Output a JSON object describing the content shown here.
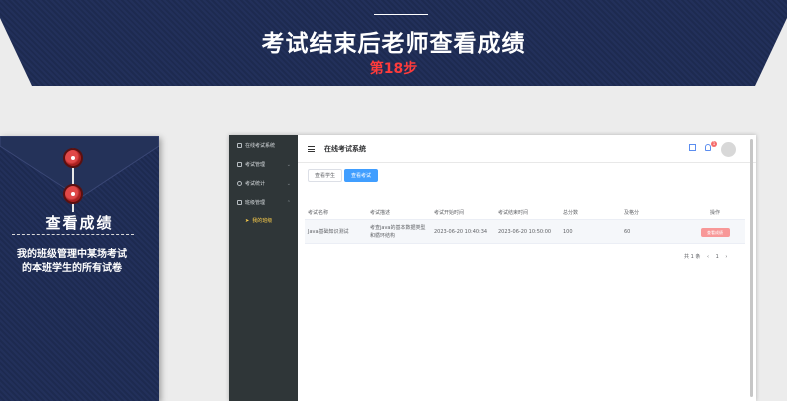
{
  "banner": {
    "title": "考试结束后老师查看成绩",
    "step": "第18步"
  },
  "card": {
    "title": "查看成绩",
    "description": "我的班级管理中某场考试的本班学生的所有试卷"
  },
  "app": {
    "title": "在线考试系统",
    "sidebar": {
      "items": [
        {
          "label": "在线考试系统",
          "icon": "monitor-icon",
          "has_chevron": false
        },
        {
          "label": "考试管理",
          "icon": "list-icon",
          "has_chevron": true
        },
        {
          "label": "考试统计",
          "icon": "chart-icon",
          "has_chevron": true
        },
        {
          "label": "班级管理",
          "icon": "folder-icon",
          "has_chevron": true
        }
      ],
      "sub_item": {
        "label": "我的班级",
        "icon": "paper-plane-icon"
      }
    },
    "header": {
      "notification_count": "1",
      "icons": [
        "fullscreen-icon",
        "bell-icon",
        "avatar"
      ]
    },
    "tabs": [
      {
        "label": "查看学生",
        "active": false
      },
      {
        "label": "查看考试",
        "active": true
      }
    ],
    "table": {
      "columns": [
        "考试名称",
        "考试描述",
        "考试开始时间",
        "考试结束时间",
        "总分数",
        "及格分",
        "操作"
      ],
      "rows": [
        {
          "name": "Java基础知识测试",
          "description": "考查java的基本数据类型和循环结构",
          "start_time": "2023-06-20 10:40:34",
          "end_time": "2023-06-20 10:50:00",
          "total_score": "100",
          "pass_score": "60",
          "action": "查看成绩"
        }
      ]
    },
    "pagination": {
      "total": "共 1 条",
      "prev": "‹",
      "page": "1",
      "next": "›"
    }
  },
  "colors": {
    "banner_bg": "#1f2c52",
    "step_red": "#ff3b3b",
    "primary_blue": "#409eff",
    "danger_button": "#f89898",
    "sidebar_bg": "#2f3638",
    "sidebar_active": "#ffd04b"
  }
}
